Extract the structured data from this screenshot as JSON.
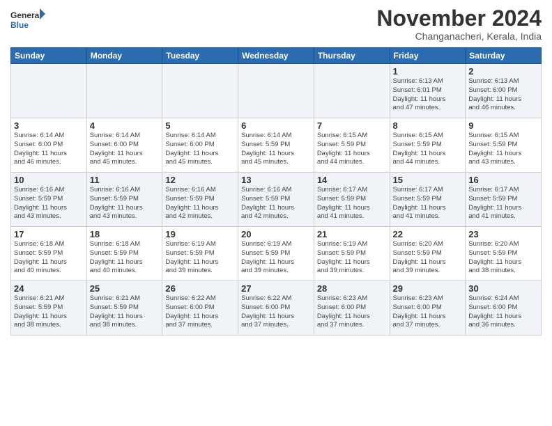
{
  "app": {
    "logo_general": "General",
    "logo_blue": "Blue",
    "month_title": "November 2024",
    "location": "Changanacheri, Kerala, India"
  },
  "calendar": {
    "headers": [
      "Sunday",
      "Monday",
      "Tuesday",
      "Wednesday",
      "Thursday",
      "Friday",
      "Saturday"
    ],
    "rows": [
      [
        {
          "day": "",
          "info": ""
        },
        {
          "day": "",
          "info": ""
        },
        {
          "day": "",
          "info": ""
        },
        {
          "day": "",
          "info": ""
        },
        {
          "day": "",
          "info": ""
        },
        {
          "day": "1",
          "info": "Sunrise: 6:13 AM\nSunset: 6:01 PM\nDaylight: 11 hours\nand 47 minutes."
        },
        {
          "day": "2",
          "info": "Sunrise: 6:13 AM\nSunset: 6:00 PM\nDaylight: 11 hours\nand 46 minutes."
        }
      ],
      [
        {
          "day": "3",
          "info": "Sunrise: 6:14 AM\nSunset: 6:00 PM\nDaylight: 11 hours\nand 46 minutes."
        },
        {
          "day": "4",
          "info": "Sunrise: 6:14 AM\nSunset: 6:00 PM\nDaylight: 11 hours\nand 45 minutes."
        },
        {
          "day": "5",
          "info": "Sunrise: 6:14 AM\nSunset: 6:00 PM\nDaylight: 11 hours\nand 45 minutes."
        },
        {
          "day": "6",
          "info": "Sunrise: 6:14 AM\nSunset: 5:59 PM\nDaylight: 11 hours\nand 45 minutes."
        },
        {
          "day": "7",
          "info": "Sunrise: 6:15 AM\nSunset: 5:59 PM\nDaylight: 11 hours\nand 44 minutes."
        },
        {
          "day": "8",
          "info": "Sunrise: 6:15 AM\nSunset: 5:59 PM\nDaylight: 11 hours\nand 44 minutes."
        },
        {
          "day": "9",
          "info": "Sunrise: 6:15 AM\nSunset: 5:59 PM\nDaylight: 11 hours\nand 43 minutes."
        }
      ],
      [
        {
          "day": "10",
          "info": "Sunrise: 6:16 AM\nSunset: 5:59 PM\nDaylight: 11 hours\nand 43 minutes."
        },
        {
          "day": "11",
          "info": "Sunrise: 6:16 AM\nSunset: 5:59 PM\nDaylight: 11 hours\nand 43 minutes."
        },
        {
          "day": "12",
          "info": "Sunrise: 6:16 AM\nSunset: 5:59 PM\nDaylight: 11 hours\nand 42 minutes."
        },
        {
          "day": "13",
          "info": "Sunrise: 6:16 AM\nSunset: 5:59 PM\nDaylight: 11 hours\nand 42 minutes."
        },
        {
          "day": "14",
          "info": "Sunrise: 6:17 AM\nSunset: 5:59 PM\nDaylight: 11 hours\nand 41 minutes."
        },
        {
          "day": "15",
          "info": "Sunrise: 6:17 AM\nSunset: 5:59 PM\nDaylight: 11 hours\nand 41 minutes."
        },
        {
          "day": "16",
          "info": "Sunrise: 6:17 AM\nSunset: 5:59 PM\nDaylight: 11 hours\nand 41 minutes."
        }
      ],
      [
        {
          "day": "17",
          "info": "Sunrise: 6:18 AM\nSunset: 5:59 PM\nDaylight: 11 hours\nand 40 minutes."
        },
        {
          "day": "18",
          "info": "Sunrise: 6:18 AM\nSunset: 5:59 PM\nDaylight: 11 hours\nand 40 minutes."
        },
        {
          "day": "19",
          "info": "Sunrise: 6:19 AM\nSunset: 5:59 PM\nDaylight: 11 hours\nand 39 minutes."
        },
        {
          "day": "20",
          "info": "Sunrise: 6:19 AM\nSunset: 5:59 PM\nDaylight: 11 hours\nand 39 minutes."
        },
        {
          "day": "21",
          "info": "Sunrise: 6:19 AM\nSunset: 5:59 PM\nDaylight: 11 hours\nand 39 minutes."
        },
        {
          "day": "22",
          "info": "Sunrise: 6:20 AM\nSunset: 5:59 PM\nDaylight: 11 hours\nand 39 minutes."
        },
        {
          "day": "23",
          "info": "Sunrise: 6:20 AM\nSunset: 5:59 PM\nDaylight: 11 hours\nand 38 minutes."
        }
      ],
      [
        {
          "day": "24",
          "info": "Sunrise: 6:21 AM\nSunset: 5:59 PM\nDaylight: 11 hours\nand 38 minutes."
        },
        {
          "day": "25",
          "info": "Sunrise: 6:21 AM\nSunset: 5:59 PM\nDaylight: 11 hours\nand 38 minutes."
        },
        {
          "day": "26",
          "info": "Sunrise: 6:22 AM\nSunset: 6:00 PM\nDaylight: 11 hours\nand 37 minutes."
        },
        {
          "day": "27",
          "info": "Sunrise: 6:22 AM\nSunset: 6:00 PM\nDaylight: 11 hours\nand 37 minutes."
        },
        {
          "day": "28",
          "info": "Sunrise: 6:23 AM\nSunset: 6:00 PM\nDaylight: 11 hours\nand 37 minutes."
        },
        {
          "day": "29",
          "info": "Sunrise: 6:23 AM\nSunset: 6:00 PM\nDaylight: 11 hours\nand 37 minutes."
        },
        {
          "day": "30",
          "info": "Sunrise: 6:24 AM\nSunset: 6:00 PM\nDaylight: 11 hours\nand 36 minutes."
        }
      ]
    ]
  }
}
